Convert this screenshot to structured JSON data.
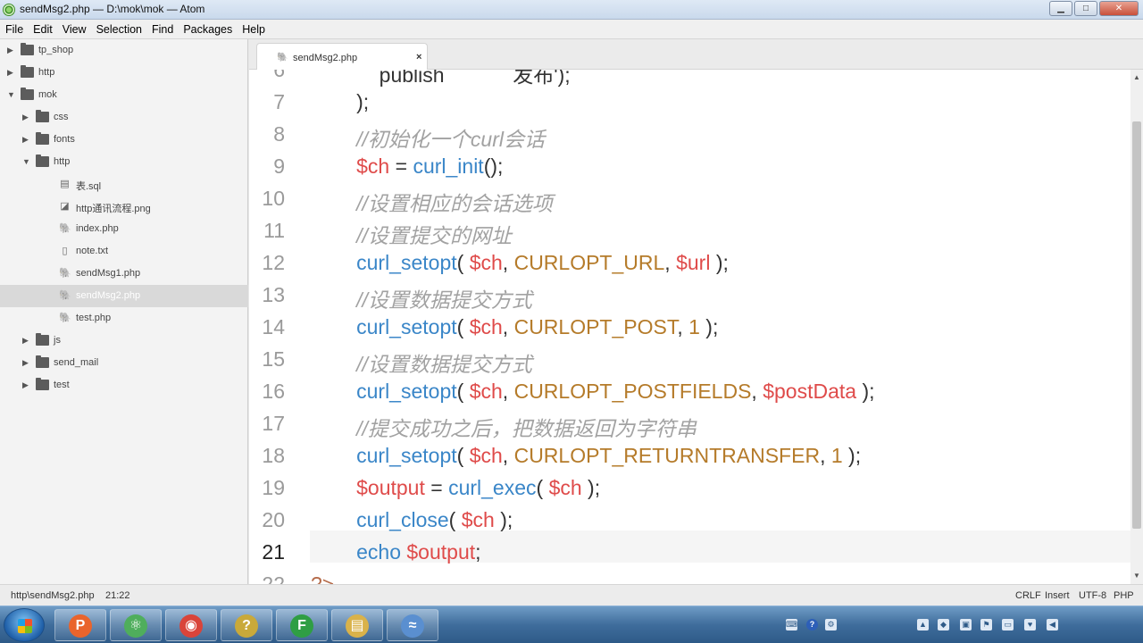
{
  "window": {
    "title": "sendMsg2.php — D:\\mok\\mok — Atom",
    "minimize_glyph": "▁",
    "maximize_glyph": "□",
    "close_glyph": "✕"
  },
  "menu": [
    "File",
    "Edit",
    "View",
    "Selection",
    "Find",
    "Packages",
    "Help"
  ],
  "tree": [
    {
      "label": "tp_shop",
      "type": "folder",
      "expanded": false,
      "depth": 0
    },
    {
      "label": "http",
      "type": "folder",
      "expanded": false,
      "depth": 0
    },
    {
      "label": "mok",
      "type": "folder",
      "expanded": true,
      "depth": 0
    },
    {
      "label": "css",
      "type": "folder",
      "expanded": false,
      "depth": 1
    },
    {
      "label": "fonts",
      "type": "folder",
      "expanded": false,
      "depth": 1
    },
    {
      "label": "http",
      "type": "folder",
      "expanded": true,
      "depth": 1
    },
    {
      "label": "表.sql",
      "type": "file",
      "icon": "database-icon",
      "depth": 2
    },
    {
      "label": "http通讯流程.png",
      "type": "file",
      "icon": "image-file-icon",
      "depth": 2
    },
    {
      "label": "index.php",
      "type": "file",
      "icon": "php-file-icon",
      "depth": 2
    },
    {
      "label": "note.txt",
      "type": "file",
      "icon": "text-file-icon",
      "depth": 2
    },
    {
      "label": "sendMsg1.php",
      "type": "file",
      "icon": "php-file-icon",
      "depth": 2
    },
    {
      "label": "sendMsg2.php",
      "type": "file",
      "icon": "php-file-icon",
      "depth": 2,
      "selected": true
    },
    {
      "label": "test.php",
      "type": "file",
      "icon": "php-file-icon",
      "depth": 2
    },
    {
      "label": "js",
      "type": "folder",
      "expanded": false,
      "depth": 1
    },
    {
      "label": "send_mail",
      "type": "folder",
      "expanded": false,
      "depth": 1
    },
    {
      "label": "test",
      "type": "folder",
      "expanded": false,
      "depth": 1
    }
  ],
  "tab": {
    "label": "sendMsg2.php",
    "close": "×"
  },
  "editor": {
    "current_line": 21,
    "lines": [
      {
        "n": 6,
        "tokens": [
          [
            "c-punct",
            "            publish            发布');"
          ]
        ],
        "clipped": true
      },
      {
        "n": 7,
        "tokens": [
          [
            "c-punct",
            "        );"
          ]
        ]
      },
      {
        "n": 8,
        "tokens": [
          [
            "c-comment",
            "        //初始化一个curl会话"
          ]
        ]
      },
      {
        "n": 9,
        "tokens": [
          [
            "c-var",
            "        $ch"
          ],
          [
            "c-punct",
            " = "
          ],
          [
            "c-func",
            "curl_init"
          ],
          [
            "c-punct",
            "();"
          ]
        ]
      },
      {
        "n": 10,
        "tokens": [
          [
            "c-comment",
            "        //设置相应的会话选项"
          ]
        ]
      },
      {
        "n": 11,
        "tokens": [
          [
            "c-comment",
            "        //设置提交的网址"
          ]
        ]
      },
      {
        "n": 12,
        "tokens": [
          [
            "c-func",
            "        curl_setopt"
          ],
          [
            "c-punct",
            "( "
          ],
          [
            "c-var",
            "$ch"
          ],
          [
            "c-punct",
            ", "
          ],
          [
            "c-const",
            "CURLOPT_URL"
          ],
          [
            "c-punct",
            ", "
          ],
          [
            "c-var",
            "$url"
          ],
          [
            "c-punct",
            " );"
          ]
        ]
      },
      {
        "n": 13,
        "tokens": [
          [
            "c-comment",
            "        //设置数据提交方式"
          ]
        ]
      },
      {
        "n": 14,
        "tokens": [
          [
            "c-func",
            "        curl_setopt"
          ],
          [
            "c-punct",
            "( "
          ],
          [
            "c-var",
            "$ch"
          ],
          [
            "c-punct",
            ", "
          ],
          [
            "c-const",
            "CURLOPT_POST"
          ],
          [
            "c-punct",
            ", "
          ],
          [
            "c-num",
            "1"
          ],
          [
            "c-punct",
            " );"
          ]
        ]
      },
      {
        "n": 15,
        "tokens": [
          [
            "c-comment",
            "        //设置数据提交方式"
          ]
        ]
      },
      {
        "n": 16,
        "tokens": [
          [
            "c-func",
            "        curl_setopt"
          ],
          [
            "c-punct",
            "( "
          ],
          [
            "c-var",
            "$ch"
          ],
          [
            "c-punct",
            ", "
          ],
          [
            "c-const",
            "CURLOPT_POSTFIELDS"
          ],
          [
            "c-punct",
            ", "
          ],
          [
            "c-var",
            "$postData"
          ],
          [
            "c-punct",
            " );"
          ]
        ]
      },
      {
        "n": 17,
        "tokens": [
          [
            "c-comment",
            "        //提交成功之后，把数据返回为字符串"
          ]
        ]
      },
      {
        "n": 18,
        "tokens": [
          [
            "c-func",
            "        curl_setopt"
          ],
          [
            "c-punct",
            "( "
          ],
          [
            "c-var",
            "$ch"
          ],
          [
            "c-punct",
            ", "
          ],
          [
            "c-const",
            "CURLOPT_RETURNTRANSFER"
          ],
          [
            "c-punct",
            ", "
          ],
          [
            "c-num",
            "1"
          ],
          [
            "c-punct",
            " );"
          ]
        ]
      },
      {
        "n": 19,
        "tokens": [
          [
            "c-var",
            "        $output"
          ],
          [
            "c-punct",
            " = "
          ],
          [
            "c-func",
            "curl_exec"
          ],
          [
            "c-punct",
            "( "
          ],
          [
            "c-var",
            "$ch"
          ],
          [
            "c-punct",
            " );"
          ]
        ]
      },
      {
        "n": 20,
        "tokens": [
          [
            "c-func",
            "        curl_close"
          ],
          [
            "c-punct",
            "( "
          ],
          [
            "c-var",
            "$ch"
          ],
          [
            "c-punct",
            " );"
          ]
        ]
      },
      {
        "n": 21,
        "tokens": [
          [
            "c-kw",
            "        echo "
          ],
          [
            "c-var",
            "$output"
          ],
          [
            "c-punct",
            ";"
          ]
        ]
      },
      {
        "n": 22,
        "tokens": [
          [
            "c-tag",
            "?>"
          ]
        ]
      }
    ]
  },
  "status": {
    "file_path": "http\\sendMsg2.php",
    "cursor": "21:22",
    "line_ending": "CRLF",
    "mode": "Insert",
    "encoding": "UTF-8",
    "grammar": "PHP"
  },
  "taskbar": {
    "apps": [
      {
        "name": "presentation-app",
        "glyph": "P",
        "color": "#e9642c"
      },
      {
        "name": "atom-app",
        "glyph": "⚛",
        "color": "#4fae5c"
      },
      {
        "name": "chrome-app",
        "glyph": "◉",
        "color": "#d9443a"
      },
      {
        "name": "help-app",
        "glyph": "?",
        "color": "#c9a93a"
      },
      {
        "name": "flow-app",
        "glyph": "F",
        "color": "#2f9e44"
      },
      {
        "name": "explorer-app",
        "glyph": "▤",
        "color": "#d9b24a"
      },
      {
        "name": "media-app",
        "glyph": "≈",
        "color": "#5a8fd0"
      }
    ]
  }
}
